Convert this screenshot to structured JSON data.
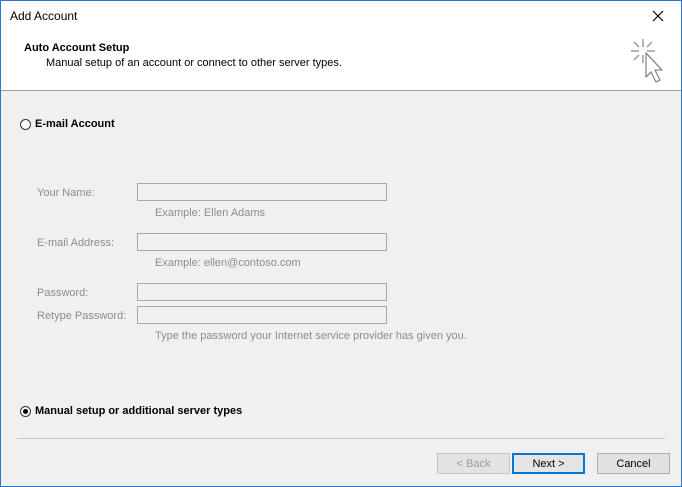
{
  "window": {
    "title": "Add Account"
  },
  "header": {
    "title": "Auto Account Setup",
    "subtitle": "Manual setup of an account or connect to other server types.",
    "icon": "cursor-sparkle-icon"
  },
  "options": {
    "email_account": {
      "label": "E-mail Account",
      "selected": false
    },
    "manual_setup": {
      "label": "Manual setup or additional server types",
      "selected": true
    }
  },
  "form": {
    "name_label": "Your Name:",
    "name_value": "",
    "name_hint": "Example: Ellen Adams",
    "email_label": "E-mail Address:",
    "email_value": "",
    "email_hint": "Example: ellen@contoso.com",
    "password_label": "Password:",
    "password_value": "",
    "retype_label": "Retype Password:",
    "retype_value": "",
    "password_hint": "Type the password your Internet service provider has given you."
  },
  "buttons": {
    "back": "< Back",
    "next": "Next >",
    "cancel": "Cancel"
  },
  "colors": {
    "accent": "#0078d7",
    "window_border": "#2b78c9",
    "disabled_text": "#8c8c8c"
  }
}
